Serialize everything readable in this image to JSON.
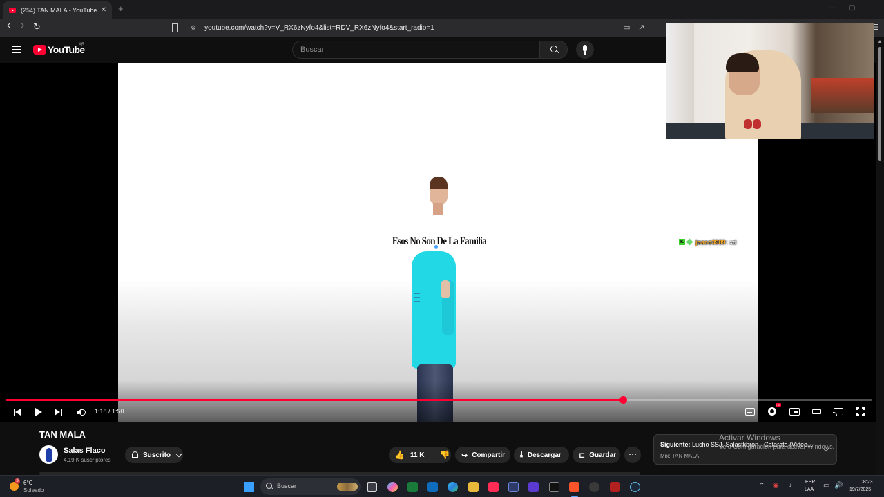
{
  "browser": {
    "tab_title": "(254) TAN MALA - YouTube",
    "tab_close": "✕",
    "new_tab": "+",
    "url": "youtube.com/watch?v=V_RX6zNyfo4&list=RDV_RX6zNyfo4&start_radio=1",
    "back": "‹",
    "forward": "›",
    "reload": "↻"
  },
  "masthead": {
    "wordmark": "YouTube",
    "country": "AR",
    "search_placeholder": "Buscar"
  },
  "video": {
    "caption": "Esos No Son De La Familia",
    "chat_badge": "K",
    "chat_user": "joaco3989",
    "chat_text": ": xd"
  },
  "player": {
    "time_current": "1:18",
    "time_separator": " / ",
    "time_total": "1:50",
    "progress": 0.713,
    "progress_color": "#ff0033",
    "hd_badge": "HD"
  },
  "meta": {
    "title": "TAN MALA",
    "channel": "Salas Flaco",
    "subscribers": "4.19 K suscriptores",
    "subscribed_label": "Suscrito",
    "likes": "11 K",
    "share": "Compartir",
    "download": "Descargar",
    "save": "Guardar",
    "more": "⋯"
  },
  "up_next": {
    "prefix": "Siguiente:",
    "title": "Lucho SSJ, Salastkbron - Catarata (Video...",
    "mix": "Mix: TAN MALA"
  },
  "watermark": {
    "line1": "Activar Windows",
    "line2": "Ve a Configuración para activar Windows."
  },
  "taskbar": {
    "weather_temp": "6°C",
    "weather_desc": "Soleado",
    "weather_badge": "3",
    "search": "Buscar",
    "lang1": "ESP",
    "lang2": "LAA",
    "time": "08:23",
    "date": "19/7/2025"
  }
}
